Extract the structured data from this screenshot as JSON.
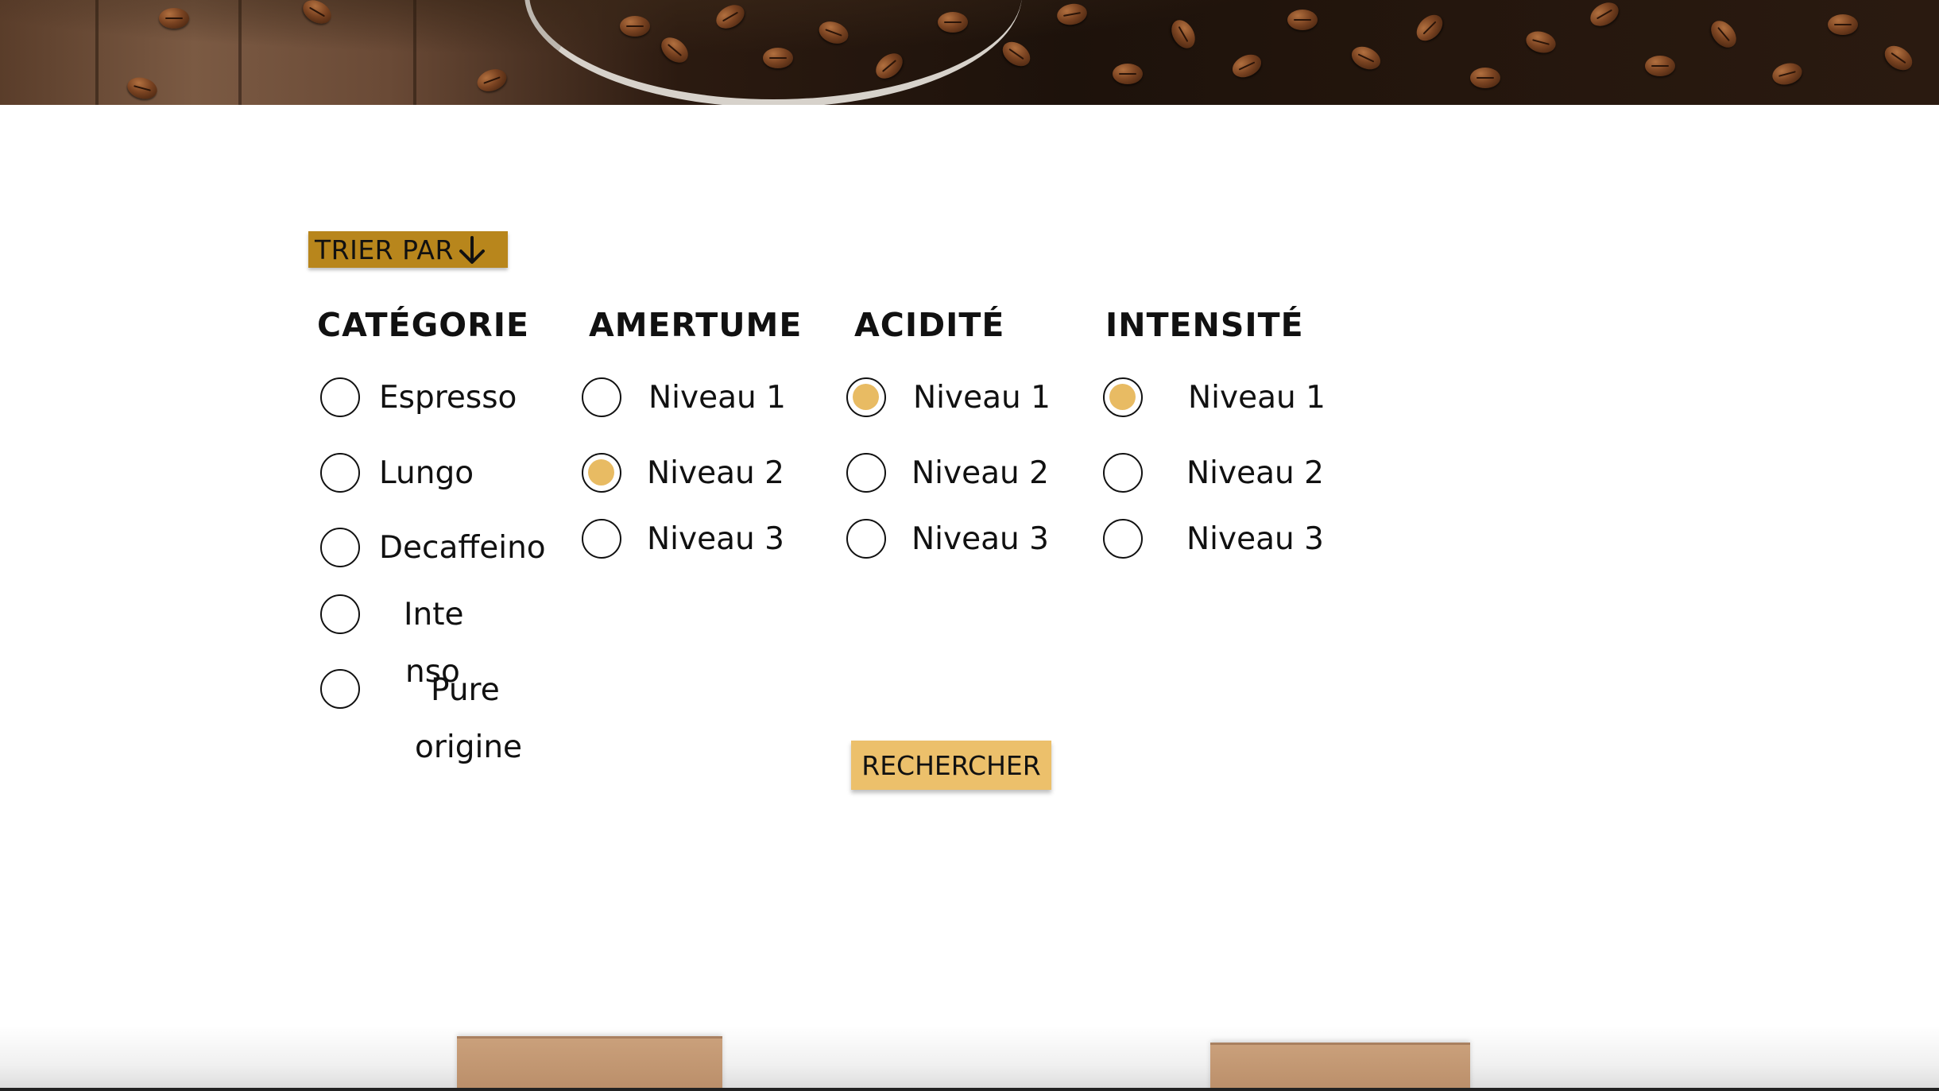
{
  "hero": {
    "image": "coffee-beans-banner"
  },
  "sort": {
    "label": "TRIER PAR",
    "icon": "arrow-down-icon"
  },
  "filters": {
    "category": {
      "title": "CATÉGORIE",
      "options": [
        {
          "label": "Espresso",
          "checked": false
        },
        {
          "label": "Lungo",
          "checked": false
        },
        {
          "label": "Decaffeino",
          "checked": false
        },
        {
          "label_line1": "Inte",
          "label_line2": "nso",
          "checked": false
        },
        {
          "label_line1": "Pure",
          "label_line2": "origine",
          "checked": false
        }
      ]
    },
    "bitterness": {
      "title": "AMERTUME",
      "options": [
        {
          "label": "Niveau 1",
          "checked": false
        },
        {
          "label": "Niveau 2",
          "checked": true
        },
        {
          "label": "Niveau 3",
          "checked": false
        }
      ]
    },
    "acidity": {
      "title": "ACIDITÉ",
      "options": [
        {
          "label": "Niveau 1",
          "checked": true
        },
        {
          "label": "Niveau 2",
          "checked": false
        },
        {
          "label": "Niveau 3",
          "checked": false
        }
      ]
    },
    "intensity": {
      "title": "INTENSITÉ",
      "options": [
        {
          "label": "Niveau 1",
          "checked": true
        },
        {
          "label": "Niveau 2",
          "checked": false
        },
        {
          "label": "Niveau 3",
          "checked": false
        }
      ]
    }
  },
  "search": {
    "label": "RECHERCHER"
  },
  "colors": {
    "sort_bg": "#b8861c",
    "accent": "#e8bb63",
    "search_bg": "#ecc06b"
  }
}
